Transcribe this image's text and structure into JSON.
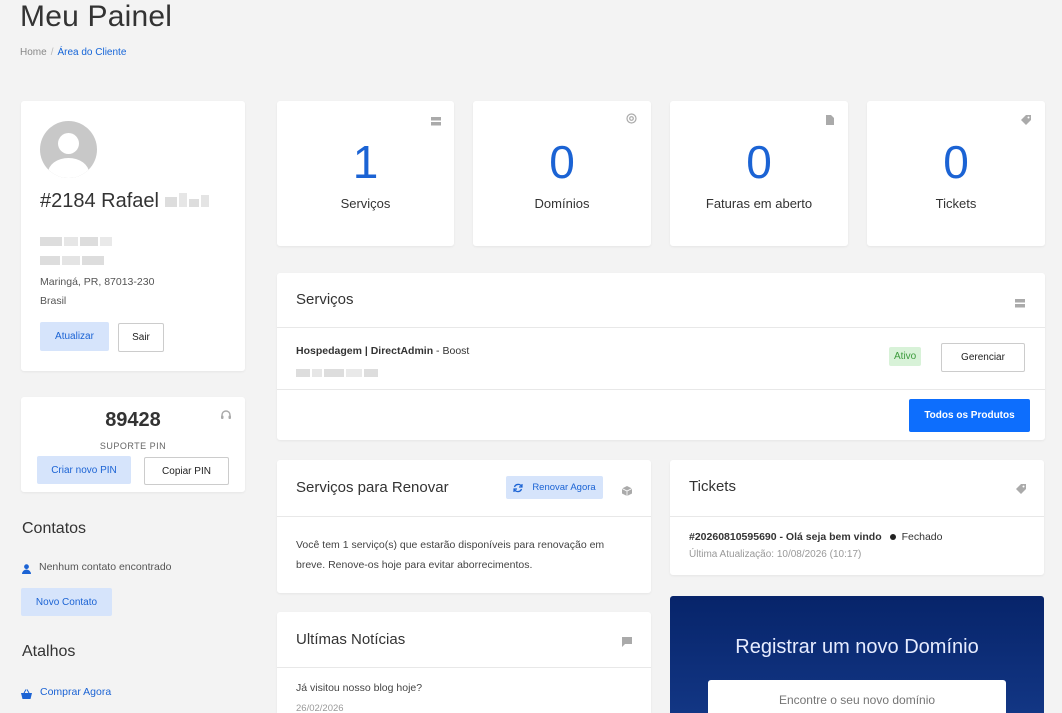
{
  "page": {
    "title": "Meu Painel"
  },
  "breadcrumb": {
    "home": "Home",
    "current": "Área do Cliente"
  },
  "profile": {
    "name": "#2184 Rafael",
    "city_line": "Maringá, PR, 87013-230",
    "country": "Brasil",
    "update_label": "Atualizar",
    "logout_label": "Sair"
  },
  "pin": {
    "value": "89428",
    "label": "SUPORTE PIN",
    "new_label": "Criar novo PIN",
    "copy_label": "Copiar PIN"
  },
  "contacts": {
    "heading": "Contatos",
    "empty_text": "Nenhum contato encontrado",
    "new_label": "Novo Contato"
  },
  "shortcuts": {
    "heading": "Atalhos",
    "buy_label": "Comprar Agora"
  },
  "stats": [
    {
      "value": "1",
      "label": "Serviços",
      "icon": "server-icon"
    },
    {
      "value": "0",
      "label": "Domínios",
      "icon": "at-icon"
    },
    {
      "value": "0",
      "label": "Faturas em aberto",
      "icon": "document-icon"
    },
    {
      "value": "0",
      "label": "Tickets",
      "icon": "tag-icon"
    }
  ],
  "services": {
    "title": "Serviços",
    "item_name_bold": "Hospedagem | DirectAdmin",
    "item_name_rest": " - Boost",
    "status": "Ativo",
    "manage_label": "Gerenciar",
    "all_products_label": "Todos os Produtos"
  },
  "renew": {
    "title": "Serviços para Renovar",
    "renew_label": "Renovar Agora",
    "message_line1": "Você tem 1 serviço(s) que estarão disponíveis para renovação em",
    "message_line2": "breve. Renove-os hoje para evitar aborrecimentos."
  },
  "tickets": {
    "title": "Tickets",
    "ticket_title": "#20260810595690 - Olá seja bem vindo",
    "ticket_status": "Fechado",
    "last_update": "Última Atualização: 10/08/2026 (10:17)"
  },
  "news": {
    "title": "Ultímas Notícias",
    "item_title": "Já visitou nosso blog hoje?",
    "item_date": "26/02/2026"
  },
  "domain": {
    "title": "Registrar um novo Domínio",
    "placeholder": "Encontre o seu novo domínio"
  },
  "colors": {
    "accent": "#1b63d4",
    "primary_button": "#0d6efd",
    "light_button": "#d6e4fb",
    "active_badge": "#d8f2d8",
    "domain_bg": "#07246a"
  }
}
